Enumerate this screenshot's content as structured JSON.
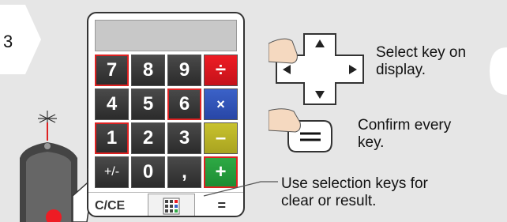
{
  "step": {
    "number": "3"
  },
  "calculator": {
    "keys": [
      {
        "label": "7",
        "type": "digit",
        "highlight": true
      },
      {
        "label": "8",
        "type": "digit",
        "highlight": false
      },
      {
        "label": "9",
        "type": "digit",
        "highlight": false
      },
      {
        "label": "÷",
        "type": "divide",
        "highlight": false
      },
      {
        "label": "4",
        "type": "digit",
        "highlight": false
      },
      {
        "label": "5",
        "type": "digit",
        "highlight": false
      },
      {
        "label": "6",
        "type": "digit",
        "highlight": true
      },
      {
        "label": "×",
        "type": "multiply",
        "highlight": false
      },
      {
        "label": "1",
        "type": "digit",
        "highlight": true
      },
      {
        "label": "2",
        "type": "digit",
        "highlight": false
      },
      {
        "label": "3",
        "type": "digit",
        "highlight": false
      },
      {
        "label": "–",
        "type": "subtract",
        "highlight": false
      },
      {
        "label": "+/-",
        "type": "pm",
        "highlight": false
      },
      {
        "label": "0",
        "type": "digit",
        "highlight": false
      },
      {
        "label": ",",
        "type": "digit",
        "highlight": false
      },
      {
        "label": "+",
        "type": "add",
        "highlight": true
      }
    ],
    "softkeys": {
      "left": "C/CE",
      "mid_icon": "calculator-icon",
      "right": "="
    }
  },
  "captions": {
    "select": "Select key on display.",
    "select_line1": "Select key on",
    "select_line2": "display.",
    "confirm_line1": "Confirm every",
    "confirm_line2": "key.",
    "softkeys_line1": "Use selection keys for",
    "softkeys_line2": "clear or result."
  },
  "colors": {
    "highlight": "#dd2222",
    "divide": "#ee1c24",
    "multiply": "#3b62c8",
    "subtract": "#c8c22e",
    "add": "#2eaa45"
  }
}
